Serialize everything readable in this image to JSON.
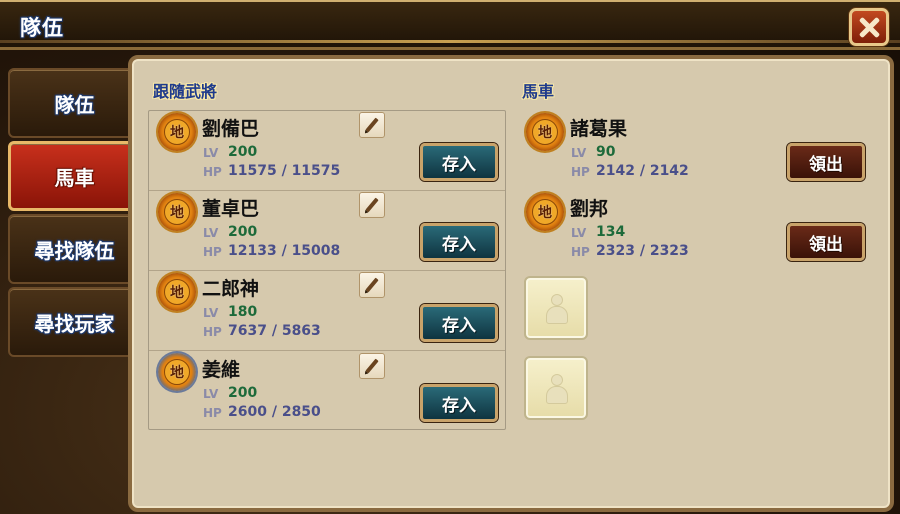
{
  "window": {
    "title": "隊伍"
  },
  "sidebar": {
    "tabs": [
      {
        "label": "隊伍"
      },
      {
        "label": "馬車"
      },
      {
        "label": "尋找隊伍"
      },
      {
        "label": "尋找玩家"
      }
    ],
    "active_index": 1
  },
  "followers": {
    "title": "跟隨武將",
    "stat_labels": {
      "lv": "LV",
      "hp": "HP"
    },
    "button_label": "存入",
    "items": [
      {
        "name": "劉備巴",
        "badge": "地",
        "lv": "200",
        "hp": "11575 / 11575"
      },
      {
        "name": "董卓巴",
        "badge": "地",
        "lv": "200",
        "hp": "12133 / 15008"
      },
      {
        "name": "二郎神",
        "badge": "地",
        "lv": "180",
        "hp": "7637 / 5863"
      },
      {
        "name": "姜維",
        "badge": "地",
        "lv": "200",
        "hp": "2600 / 2850"
      }
    ]
  },
  "carriage": {
    "title": "馬車",
    "button_label": "領出",
    "items": [
      {
        "name": "諸葛果",
        "badge": "地",
        "lv": "90",
        "hp": "2142 / 2142"
      },
      {
        "name": "劉邦",
        "badge": "地",
        "lv": "134",
        "hp": "2323 / 2323"
      }
    ],
    "empty_slots": 2
  },
  "colors": {
    "active_tab": "#c8301c",
    "store_button": "#1f5560",
    "withdraw_button": "#55210f",
    "panel": "#d6c9ad"
  }
}
